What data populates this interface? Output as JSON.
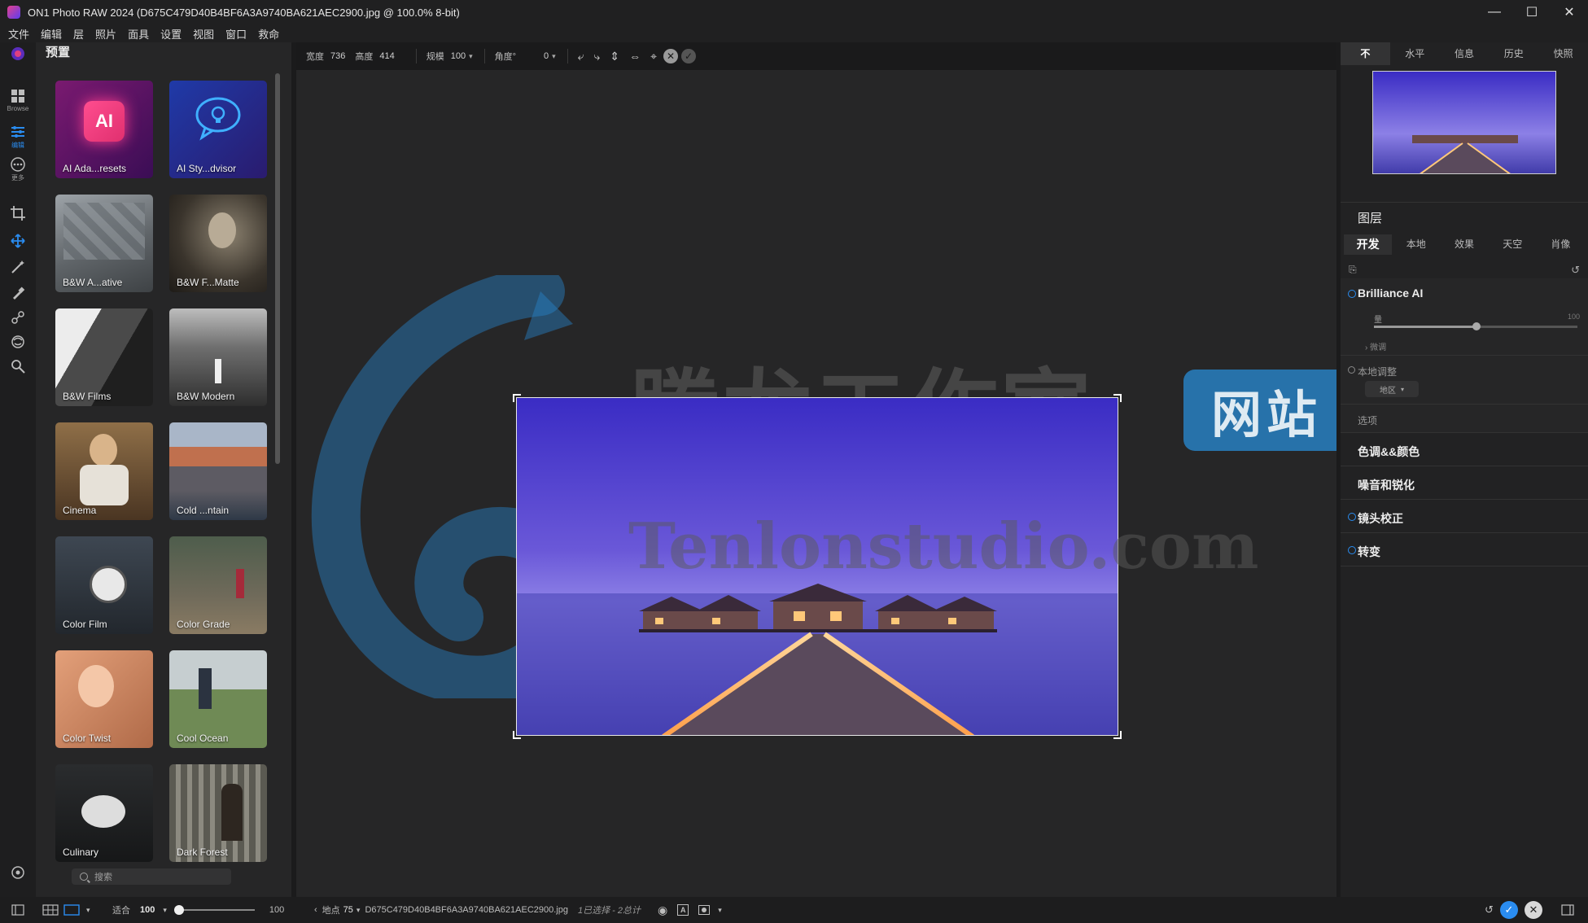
{
  "window": {
    "title": "ON1 Photo RAW 2024 (D675C479D40B4BF6A3A9740BA621AEC2900.jpg @ 100.0% 8-bit)",
    "controls": [
      "—",
      "☐",
      "✕"
    ]
  },
  "menu": [
    "文件",
    "编辑",
    "层",
    "照片",
    "面具",
    "设置",
    "视图",
    "窗口",
    "救命"
  ],
  "rail": {
    "browse_label": "Browse",
    "edit_label": "编辑",
    "more_label": "更多"
  },
  "presets": {
    "header": "预置",
    "search_placeholder": "搜索",
    "tiles": [
      {
        "name": "AI Ada...resets"
      },
      {
        "name": "AI Sty...dvisor"
      },
      {
        "name": "B&W A...ative"
      },
      {
        "name": "B&W F...Matte"
      },
      {
        "name": "B&W Films"
      },
      {
        "name": "B&W Modern"
      },
      {
        "name": "Cinema"
      },
      {
        "name": "Cold ...ntain"
      },
      {
        "name": "Color Film"
      },
      {
        "name": "Color Grade"
      },
      {
        "name": "Color Twist"
      },
      {
        "name": "Cool Ocean"
      },
      {
        "name": "Culinary"
      },
      {
        "name": "Dark Forest"
      }
    ]
  },
  "cropbar": {
    "width_label": "宽度",
    "width_value": "736",
    "height_label": "高度",
    "height_value": "414",
    "scale_label": "规模",
    "scale_value": "100",
    "angle_label": "角度°",
    "angle_value": "0"
  },
  "watermark": {
    "cn": "腾龙工作室",
    "en": "Tenlonstudio.com",
    "badge": "网站"
  },
  "right": {
    "top_tabs": [
      "不",
      "水平",
      "信息",
      "历史",
      "快照"
    ],
    "active_top_tab": 0,
    "layers_title": "图层",
    "dev_tabs": [
      "开发",
      "本地",
      "效果",
      "天空",
      "肖像"
    ],
    "active_dev_tab": 0,
    "brilliance": {
      "title": "Brilliance AI",
      "amount_label": "量",
      "amount_value": "100",
      "fine_tune": "微调",
      "local_adjust": "本地调整",
      "region_select": "地区",
      "options": "选项"
    },
    "sections": [
      "色调&&颜色",
      "噪音和锐化",
      "镜头校正",
      "转变"
    ]
  },
  "bottom": {
    "fit_label": "适合",
    "zoom_value": "100",
    "zoom_max": "100",
    "location_label": "地点",
    "location_value": "75",
    "filename": "D675C479D40B4BF6A3A9740BA621AEC2900.jpg",
    "selection_info": "1已选择 - 2总计"
  },
  "colors": {
    "accent": "#2a8cf0",
    "background": "#1b1b1c",
    "panel": "#262627"
  }
}
